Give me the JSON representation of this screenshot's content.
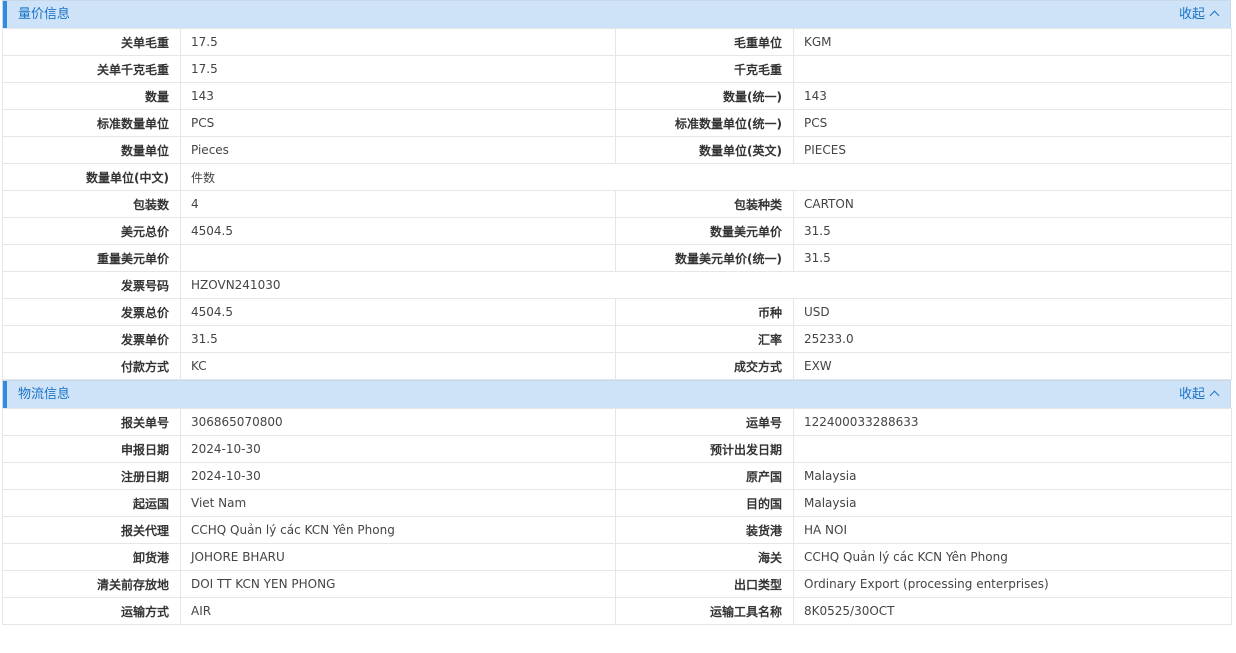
{
  "sections": [
    {
      "title": "量价信息",
      "collapse_label": "收起",
      "rows": [
        [
          {
            "label": "关单毛重",
            "value": "17.5"
          },
          {
            "label": "毛重单位",
            "value": "KGM"
          }
        ],
        [
          {
            "label": "关单千克毛重",
            "value": "17.5"
          },
          {
            "label": "千克毛重",
            "value": ""
          }
        ],
        [
          {
            "label": "数量",
            "value": "143"
          },
          {
            "label": "数量(统一)",
            "value": "143"
          }
        ],
        [
          {
            "label": "标准数量单位",
            "value": "PCS"
          },
          {
            "label": "标准数量单位(统一)",
            "value": "PCS"
          }
        ],
        [
          {
            "label": "数量单位",
            "value": "Pieces"
          },
          {
            "label": "数量单位(英文)",
            "value": "PIECES"
          }
        ],
        [
          {
            "label": "数量单位(中文)",
            "value": "件数"
          }
        ],
        [
          {
            "label": "包装数",
            "value": "4"
          },
          {
            "label": "包装种类",
            "value": "CARTON"
          }
        ],
        [
          {
            "label": "美元总价",
            "value": "4504.5"
          },
          {
            "label": "数量美元单价",
            "value": "31.5"
          }
        ],
        [
          {
            "label": "重量美元单价",
            "value": ""
          },
          {
            "label": "数量美元单价(统一)",
            "value": "31.5"
          }
        ],
        [
          {
            "label": "发票号码",
            "value": "HZOVN241030"
          }
        ],
        [
          {
            "label": "发票总价",
            "value": "4504.5"
          },
          {
            "label": "币种",
            "value": "USD"
          }
        ],
        [
          {
            "label": "发票单价",
            "value": "31.5"
          },
          {
            "label": "汇率",
            "value": "25233.0"
          }
        ],
        [
          {
            "label": "付款方式",
            "value": "KC"
          },
          {
            "label": "成交方式",
            "value": "EXW"
          }
        ]
      ]
    },
    {
      "title": "物流信息",
      "collapse_label": "收起",
      "rows": [
        [
          {
            "label": "报关单号",
            "value": "306865070800"
          },
          {
            "label": "运单号",
            "value": "122400033288633"
          }
        ],
        [
          {
            "label": "申报日期",
            "value": "2024-10-30"
          },
          {
            "label": "预计出发日期",
            "value": ""
          }
        ],
        [
          {
            "label": "注册日期",
            "value": "2024-10-30"
          },
          {
            "label": "原产国",
            "value": "Malaysia"
          }
        ],
        [
          {
            "label": "起运国",
            "value": "Viet Nam"
          },
          {
            "label": "目的国",
            "value": "Malaysia"
          }
        ],
        [
          {
            "label": "报关代理",
            "value": "CCHQ Quản lý các KCN Yên Phong"
          },
          {
            "label": "装货港",
            "value": "HA NOI"
          }
        ],
        [
          {
            "label": "卸货港",
            "value": "JOHORE BHARU"
          },
          {
            "label": "海关",
            "value": "CCHQ Quản lý các KCN Yên Phong"
          }
        ],
        [
          {
            "label": "清关前存放地",
            "value": "DOI TT KCN YEN PHONG"
          },
          {
            "label": "出口类型",
            "value": "Ordinary Export (processing enterprises)"
          }
        ],
        [
          {
            "label": "运输方式",
            "value": "AIR"
          },
          {
            "label": "运输工具名称",
            "value": "8K0525/30OCT"
          }
        ]
      ]
    }
  ]
}
